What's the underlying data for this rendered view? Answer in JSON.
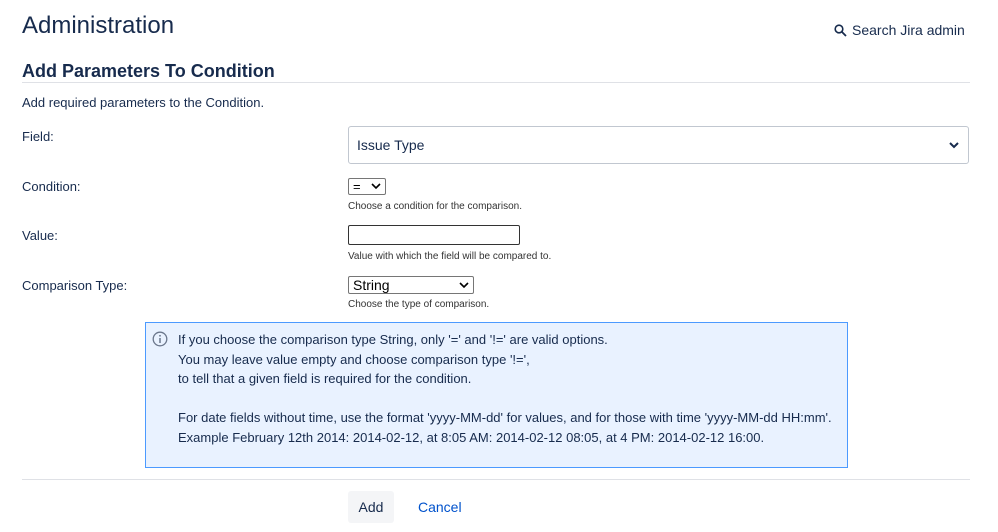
{
  "header": {
    "title": "Administration",
    "search_label": "Search Jira admin"
  },
  "form": {
    "title": "Add Parameters To Condition",
    "description": "Add required parameters to the Condition.",
    "field": {
      "label": "Field:",
      "value": "Issue Type"
    },
    "condition": {
      "label": "Condition:",
      "value": "=",
      "help": "Choose a condition for the comparison."
    },
    "value": {
      "label": "Value:",
      "value": "",
      "help": "Value with which the field will be compared to."
    },
    "comparison_type": {
      "label": "Comparison Type:",
      "value": "String",
      "help": "Choose the type of comparison."
    }
  },
  "info": {
    "lines": [
      "If you choose the comparison type String, only '=' and '!=' are valid options.",
      "You may leave value empty and choose comparison type '!=',",
      "to tell that a given field is required for the condition.",
      "",
      "For date fields without time, use the format 'yyyy-MM-dd' for values, and for those with time 'yyyy-MM-dd HH:mm'.",
      "Example February 12th 2014: 2014-02-12, at 8:05 AM: 2014-02-12 08:05, at 4 PM: 2014-02-12 16:00."
    ]
  },
  "actions": {
    "add": "Add",
    "cancel": "Cancel"
  }
}
